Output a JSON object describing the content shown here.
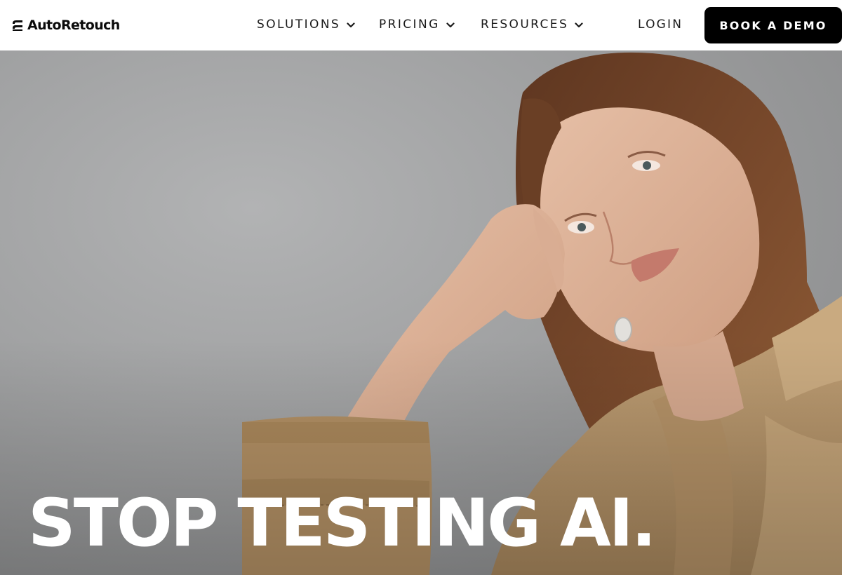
{
  "header": {
    "logo_text": "AutoRetouch",
    "nav": [
      {
        "label": "SOLUTIONS",
        "icon": "chevron-down-icon"
      },
      {
        "label": "PRICING",
        "icon": "chevron-down-icon"
      },
      {
        "label": "RESOURCES",
        "icon": "chevron-down-icon"
      }
    ],
    "login_label": "LOGIN",
    "cta_label": "BOOK A DEMO"
  },
  "hero": {
    "headline": "STOP TESTING AI.",
    "image": "model-in-beige-trench-coat-photo"
  },
  "colors": {
    "cta_background": "#000000",
    "cta_text": "#ffffff",
    "headline_text": "#ffffff",
    "hero_background": "#a9aaab",
    "coat": "#b4936a",
    "hair": "#6e4228"
  }
}
